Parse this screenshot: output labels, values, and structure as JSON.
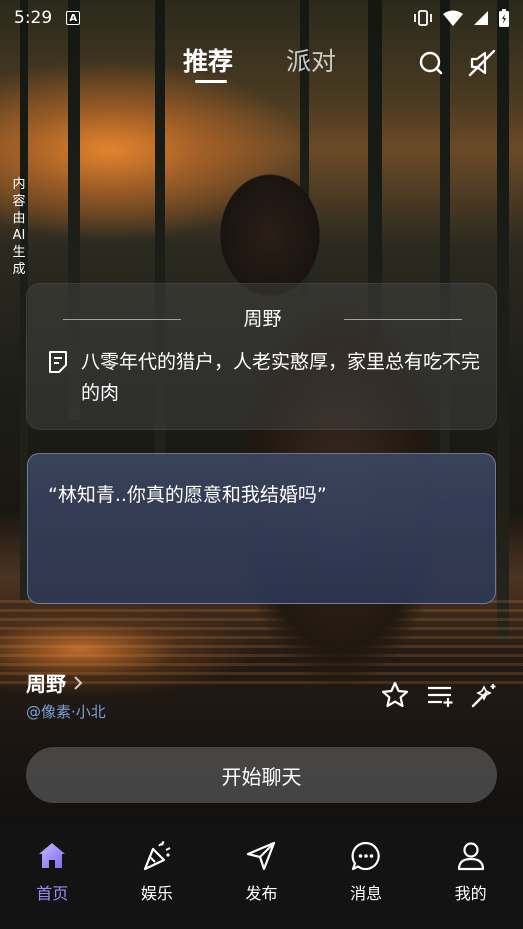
{
  "status_bar": {
    "time": "5:29",
    "badge": "A"
  },
  "top_nav": {
    "tabs": [
      {
        "label": "推荐",
        "active": true
      },
      {
        "label": "派对",
        "active": false
      }
    ],
    "search_icon": "search-icon",
    "mute_icon": "speaker-muted-icon"
  },
  "ai_notice": "内容由AI生成",
  "character_card": {
    "name": "周野",
    "description": "八零年代的猎户，人老实憨厚，家里总有吃不完的肉"
  },
  "dialog": {
    "text": "“林知青..你真的愿意和我结婚吗”"
  },
  "creator": {
    "name": "周野",
    "handle": "@像素·小北"
  },
  "actions": [
    "star-icon",
    "playlist-add-icon",
    "magic-wand-icon"
  ],
  "start_chat_label": "开始聊天",
  "bottom_nav": [
    {
      "label": "首页",
      "icon": "home-icon",
      "active": true
    },
    {
      "label": "娱乐",
      "icon": "party-popper-icon",
      "active": false
    },
    {
      "label": "发布",
      "icon": "send-icon",
      "active": false
    },
    {
      "label": "消息",
      "icon": "message-icon",
      "active": false
    },
    {
      "label": "我的",
      "icon": "profile-icon",
      "active": false
    }
  ],
  "colors": {
    "active_tab": "#9d8bf5",
    "handle": "#7aa0d8",
    "dialog_bg": "#38446a"
  }
}
